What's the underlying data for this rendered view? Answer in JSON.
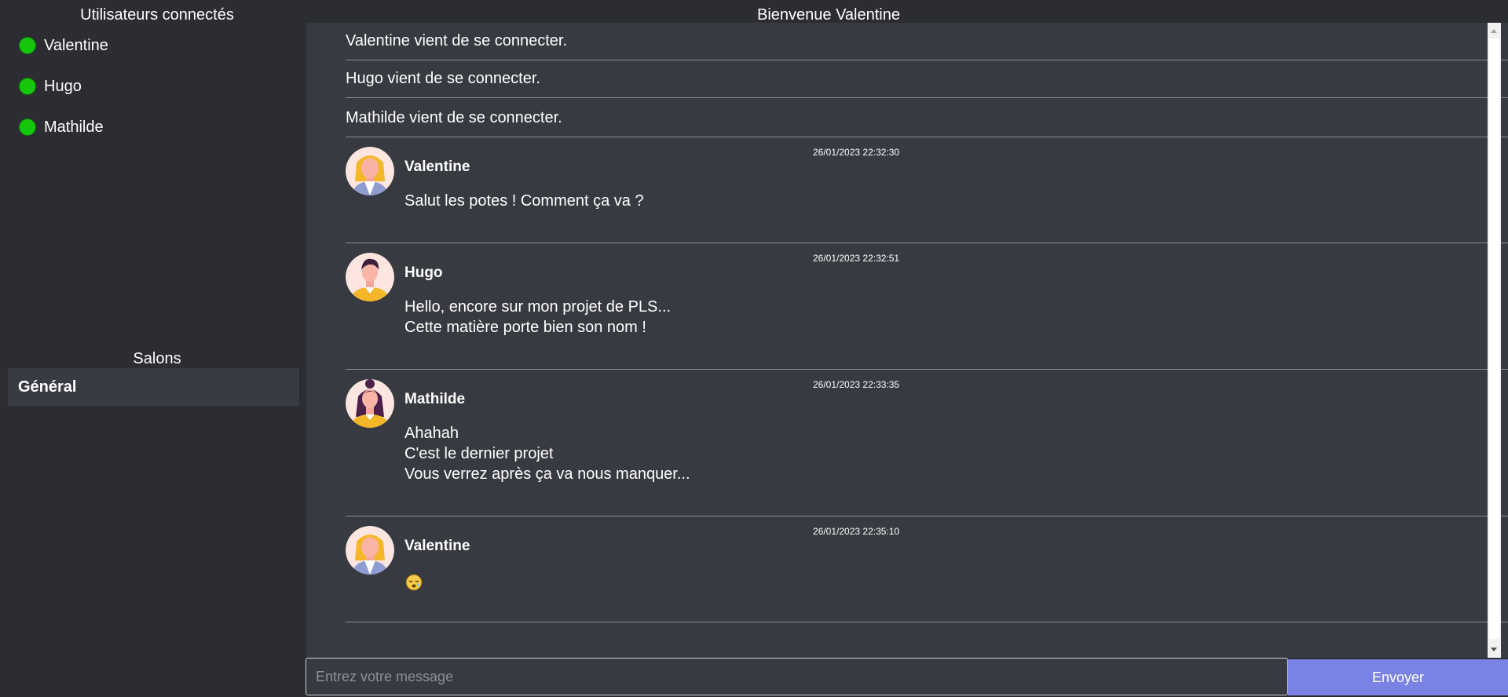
{
  "sidebar": {
    "users_title": "Utilisateurs connectés",
    "users": [
      {
        "name": "Valentine",
        "status_color": "#16c60c"
      },
      {
        "name": "Hugo",
        "status_color": "#16c60c"
      },
      {
        "name": "Mathilde",
        "status_color": "#16c60c"
      }
    ],
    "rooms_title": "Salons",
    "rooms": [
      {
        "name": "Général",
        "active": true
      }
    ]
  },
  "header": {
    "title": "Bienvenue Valentine"
  },
  "system_messages": [
    {
      "text": "Valentine vient de se connecter."
    },
    {
      "text": "Hugo vient de se connecter."
    },
    {
      "text": "Mathilde vient de se connecter."
    }
  ],
  "messages": [
    {
      "author": "Valentine",
      "timestamp": "26/01/2023 22:32:30",
      "avatar": "woman-blonde-avatar",
      "lines": [
        "Salut les potes ! Comment ça va ?"
      ]
    },
    {
      "author": "Hugo",
      "timestamp": "26/01/2023 22:32:51",
      "avatar": "man-dark-hair-avatar",
      "lines": [
        "Hello, encore sur mon projet de PLS...",
        "Cette matière porte bien son nom !"
      ]
    },
    {
      "author": "Mathilde",
      "timestamp": "26/01/2023 22:33:35",
      "avatar": "woman-dark-hair-avatar",
      "lines": [
        "Ahahah",
        "C'est le dernier projet",
        "Vous verrez après ça va nous manquer..."
      ]
    },
    {
      "author": "Valentine",
      "timestamp": "26/01/2023 22:35:10",
      "avatar": "woman-blonde-avatar",
      "emoji": "sleeping-face-emoji"
    }
  ],
  "composer": {
    "placeholder": "Entrez votre message",
    "value": "",
    "send_label": "Envoyer"
  },
  "colors": {
    "background": "#2c2d32",
    "panel": "#383a41",
    "online": "#16c60c",
    "accent": "#7a82e3"
  }
}
